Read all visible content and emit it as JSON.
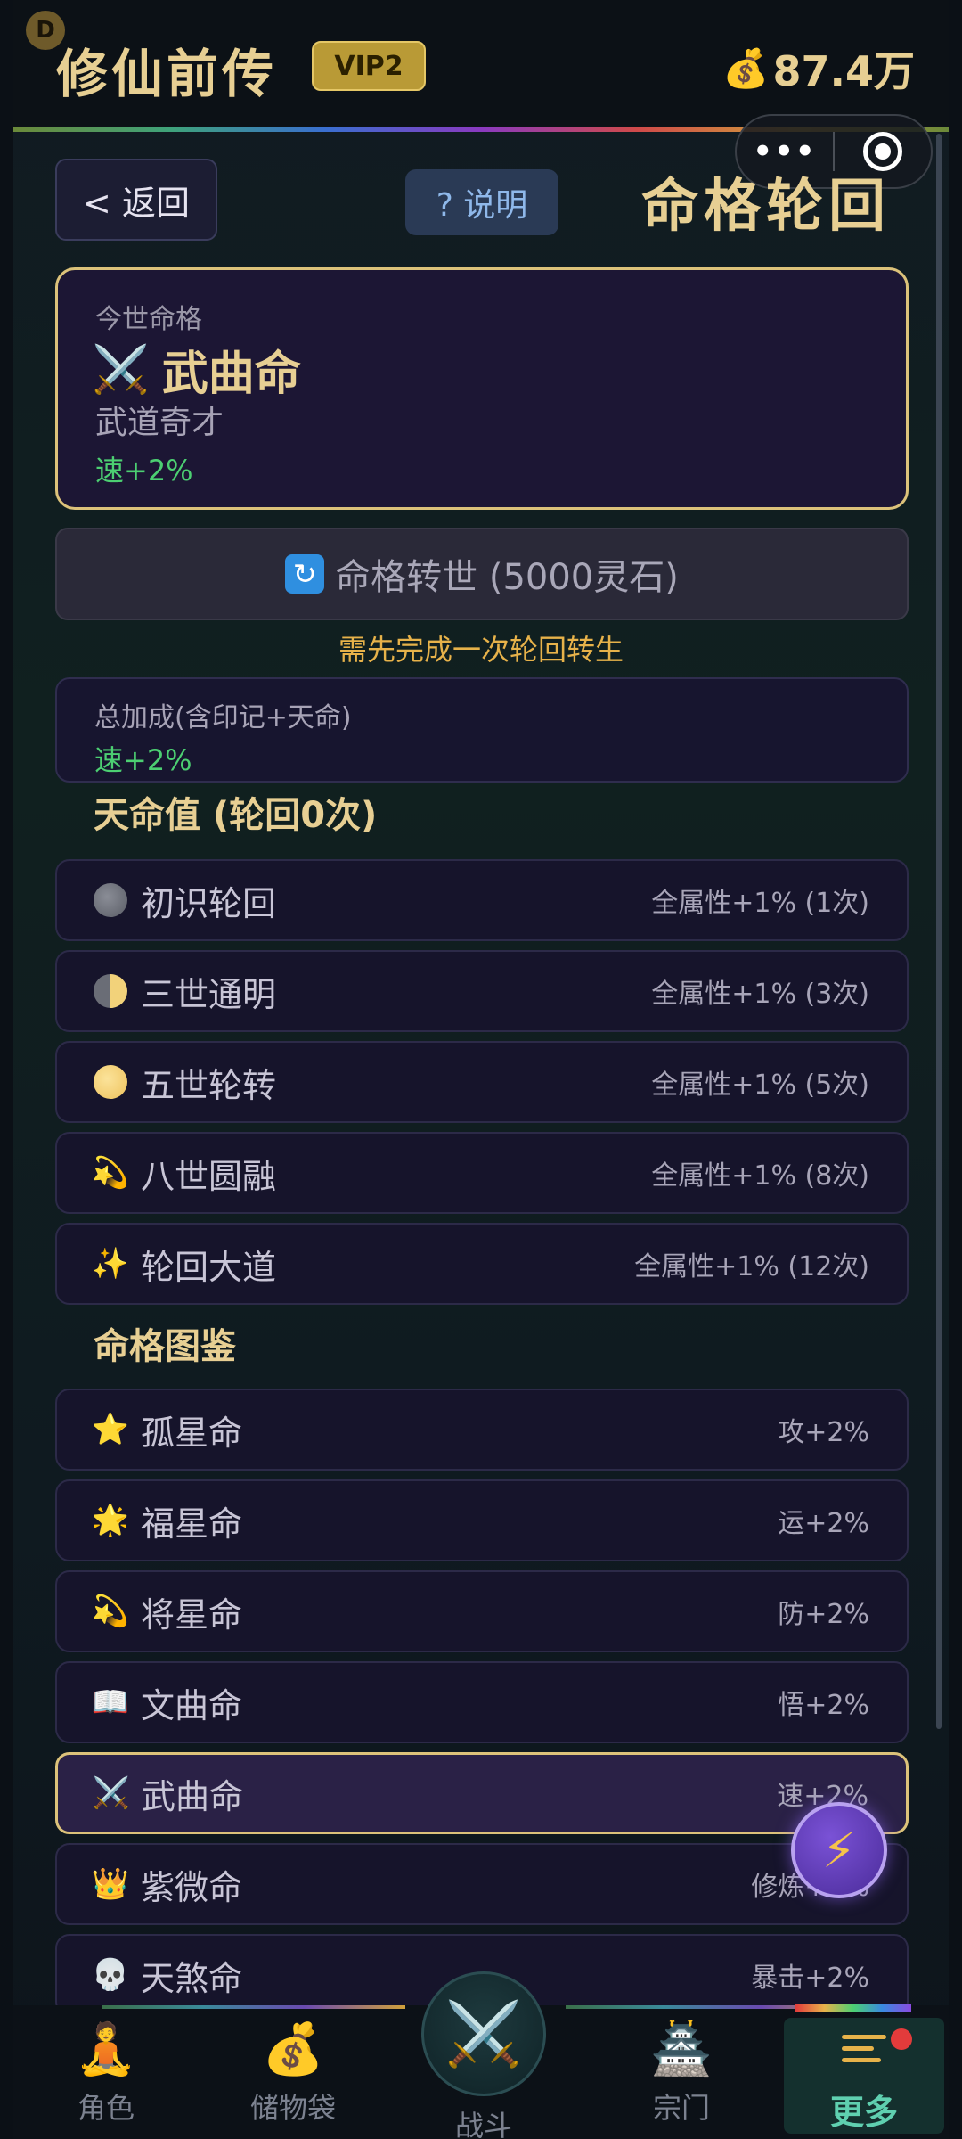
{
  "header": {
    "badge_letter": "D",
    "app_title": "修仙前传",
    "vip_label": "VIP2",
    "coin_icon": "money-bag-icon",
    "coins": "87.4万"
  },
  "topbar": {
    "back_label": "< 返回",
    "help_label": "? 说明",
    "page_title": "命格轮回"
  },
  "current_fate": {
    "section_label": "今世命格",
    "icon": "crossed-swords-icon",
    "name": "武曲命",
    "description": "武道奇才",
    "bonus": "速+2%"
  },
  "rebirth": {
    "button_label": "命格转世 (5000灵石)",
    "note": "需先完成一次轮回转生"
  },
  "total_bonus": {
    "label": "总加成(含印记+天命)",
    "value": "速+2%"
  },
  "destiny_section": {
    "title": "天命值 (轮回0次)",
    "items": [
      {
        "icon": "new-moon-icon",
        "name": "初识轮回",
        "effect": "全属性+1% (1次)"
      },
      {
        "icon": "half-moon-icon",
        "name": "三世通明",
        "effect": "全属性+1% (3次)"
      },
      {
        "icon": "full-moon-icon",
        "name": "五世轮转",
        "effect": "全属性+1% (5次)"
      },
      {
        "icon": "shooting-star-icon",
        "name": "八世圆融",
        "effect": "全属性+1% (8次)"
      },
      {
        "icon": "sparkles-icon",
        "name": "轮回大道",
        "effect": "全属性+1% (12次)"
      }
    ]
  },
  "codex_section": {
    "title": "命格图鉴",
    "items": [
      {
        "icon": "star-icon",
        "name": "孤星命",
        "effect": "攻+2%"
      },
      {
        "icon": "sun-icon",
        "name": "福星命",
        "effect": "运+2%"
      },
      {
        "icon": "shooting-star-icon",
        "name": "将星命",
        "effect": "防+2%"
      },
      {
        "icon": "book-icon",
        "name": "文曲命",
        "effect": "悟+2%"
      },
      {
        "icon": "crossed-swords-icon",
        "name": "武曲命",
        "effect": "速+2%",
        "selected": true
      },
      {
        "icon": "crown-icon",
        "name": "紫微命",
        "effect": "修炼+2%"
      },
      {
        "icon": "skull-icon",
        "name": "天煞命",
        "effect": "暴击+2%"
      }
    ]
  },
  "bottom_nav": {
    "items": [
      {
        "label": "角色",
        "icon": "meditating-figure-icon"
      },
      {
        "label": "储物袋",
        "icon": "treasure-bag-icon"
      },
      {
        "label": "战斗",
        "icon": "crossed-swords-icon"
      },
      {
        "label": "宗门",
        "icon": "temple-icon"
      },
      {
        "label": "更多",
        "icon": "menu-icon",
        "active": true
      }
    ]
  },
  "colors": {
    "gold": "#e7cf93",
    "green": "#4ccf72",
    "orange_note": "#e7b24a",
    "card_bg": "#16142b",
    "selected_border": "#dcc27a",
    "active_nav": "#5fd0b0"
  }
}
